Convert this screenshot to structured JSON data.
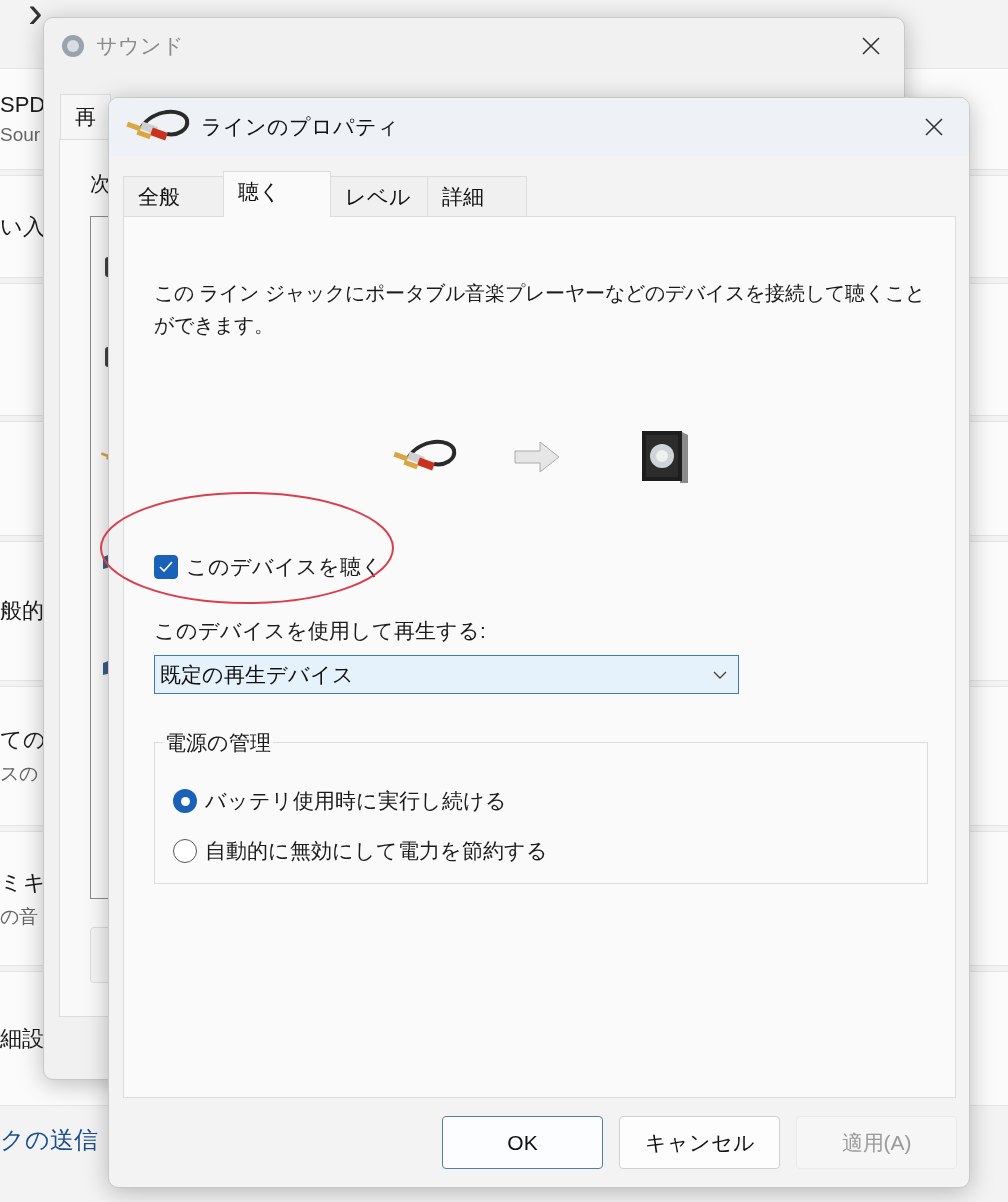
{
  "settings_page": {
    "chevron": "›",
    "rows": [
      {
        "title": "SPD",
        "subtitle": "Sour"
      },
      {
        "title": "い入"
      },
      {},
      {},
      {
        "title": "般的"
      },
      {
        "title": "ての",
        "subtitle": "スの"
      },
      {
        "title": "ミキ",
        "subtitle": "の音"
      },
      {
        "title": "細設"
      }
    ],
    "link": "クの送信"
  },
  "sound_dialog": {
    "title": "サウンド",
    "tab": "再",
    "text": "次"
  },
  "properties_dialog": {
    "title": "ラインのプロパティ",
    "tabs": [
      {
        "label": "全般",
        "selected": false
      },
      {
        "label": "聴く",
        "selected": true
      },
      {
        "label": "レベル",
        "selected": false
      },
      {
        "label": "詳細",
        "selected": false
      }
    ],
    "description": "この ライン ジャックにポータブル音楽プレーヤーなどのデバイスを接続して聴くことができます。",
    "listen_checkbox": {
      "label": "このデバイスを聴く",
      "checked": true
    },
    "playback_label": "このデバイスを使用して再生する:",
    "playback_device": {
      "value": "既定の再生デバイス"
    },
    "power_group": {
      "title": "電源の管理",
      "options": [
        {
          "label": "バッテリ使用時に実行し続ける",
          "selected": true
        },
        {
          "label": "自動的に無効にして電力を節約する",
          "selected": false
        }
      ]
    },
    "buttons": [
      {
        "label": "OK",
        "kind": "default",
        "disabled": false
      },
      {
        "label": "キャンセル",
        "kind": "normal",
        "disabled": false
      },
      {
        "label": "適用(A)",
        "kind": "normal",
        "disabled": true
      }
    ]
  }
}
